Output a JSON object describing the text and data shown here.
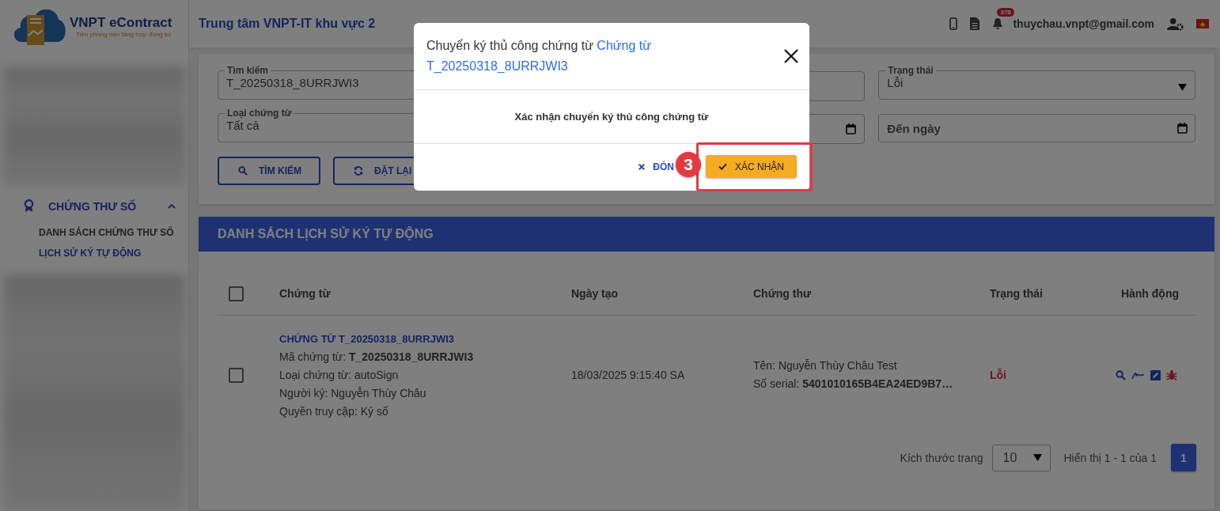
{
  "header": {
    "brand": "VNPT eContract",
    "tagline": "Tiên phong nền tảng hợp đồng số",
    "org": "Trung tâm VNPT-IT khu vực 2",
    "notification_count": "378",
    "user_email": "thuychau.vnpt@gmail.com"
  },
  "sidebar": {
    "groups": [
      {
        "label": "CHỨNG THƯ SỐ",
        "expanded": true,
        "children": [
          {
            "label": "DANH SÁCH CHỨNG THƯ SỐ",
            "selected": false
          },
          {
            "label": "LỊCH SỬ KÝ TỰ ĐỘNG",
            "selected": true
          }
        ]
      }
    ]
  },
  "filters": {
    "search": {
      "label": "Tìm kiếm",
      "value": "T_20250318_8URRJWI3"
    },
    "status": {
      "label": "Trạng thái",
      "value": "Lỗi"
    },
    "doc_type": {
      "label": "Loại chứng từ",
      "value": "Tất cả"
    },
    "to_date": {
      "placeholder": "Đến ngày"
    },
    "buttons": [
      {
        "kind": "search",
        "label": "TÌM KIẾM"
      },
      {
        "kind": "reset",
        "label": "ĐẶT LẠI"
      }
    ]
  },
  "table": {
    "title": "DANH SÁCH LỊCH SỬ KÝ TỰ ĐỘNG",
    "columns": [
      "Chứng từ",
      "Ngày tạo",
      "Chứng thư",
      "Trạng thái",
      "Hành động"
    ],
    "all_checked": false,
    "rows": [
      {
        "checked": false,
        "doc_title": "CHỨNG TỪ T_20250318_8URRJWI3",
        "doc_lines": [
          "Mã chứng từ: **T_20250318_8URRJWI3**",
          "Loại chứng từ: autoSign",
          "Người ký: Nguyễn Thùy Châu",
          "Quyền truy cập: Ký số"
        ],
        "created": "18/03/2025 9:15:40 SA",
        "cert_lines": [
          "Tên: Nguyễn Thùy Châu Test",
          "Số serial: **5401010165B4EA24ED9B7…**"
        ],
        "status": "Lỗi"
      }
    ]
  },
  "pagination": {
    "page_size_label": "Kích thước trang",
    "page_size": "10",
    "summary": "Hiển thị 1 - 1 của 1",
    "pages": [
      {
        "label": "1",
        "selected": true
      }
    ]
  },
  "dialog": {
    "title": "Chuyển ký thủ công chứng từ",
    "title_link": "Chứng từ T_20250318_8URRJWI3",
    "message": "Xác nhận chuyển ký thủ công chứng từ",
    "buttons": [
      {
        "kind": "close",
        "label": "ĐÓN"
      },
      {
        "kind": "confirm",
        "label": "XÁC NHẬN"
      }
    ]
  },
  "annotation": {
    "step": "3"
  }
}
